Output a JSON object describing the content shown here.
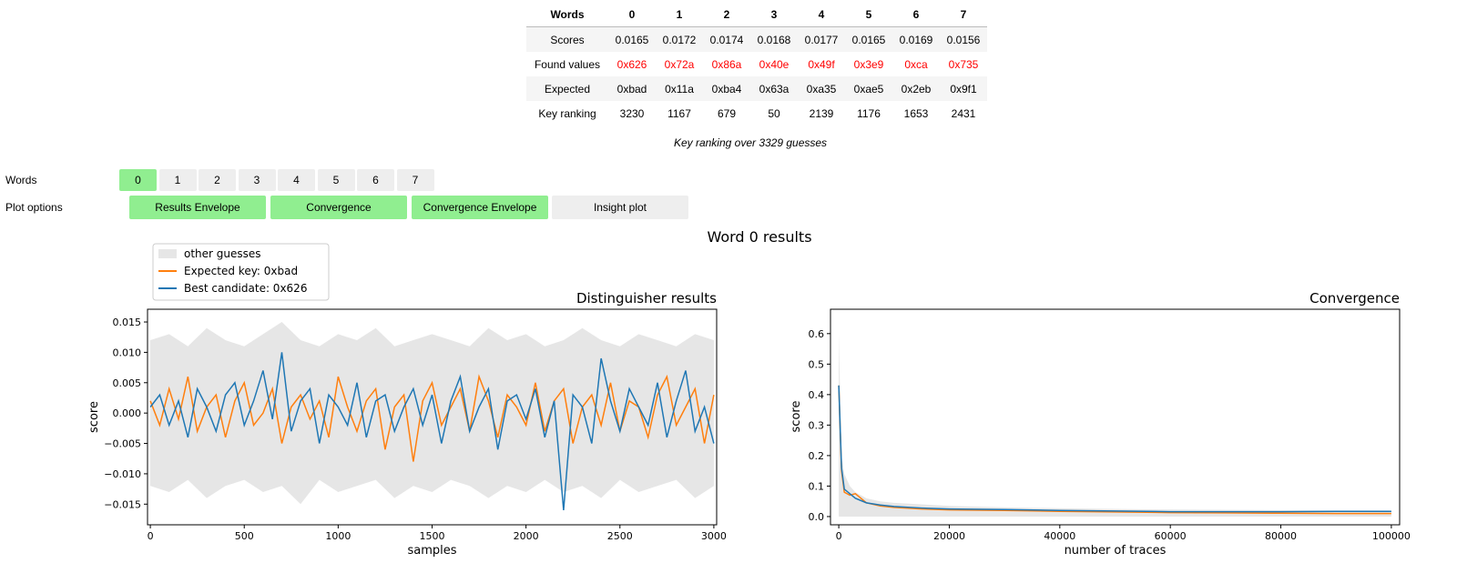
{
  "table": {
    "header_label": "Words",
    "columns": [
      "0",
      "1",
      "2",
      "3",
      "4",
      "5",
      "6",
      "7"
    ],
    "rows": [
      {
        "label": "Scores",
        "values": [
          "0.0165",
          "0.0172",
          "0.0174",
          "0.0168",
          "0.0177",
          "0.0165",
          "0.0169",
          "0.0156"
        ]
      },
      {
        "label": "Found values",
        "values": [
          "0x626",
          "0x72a",
          "0x86a",
          "0x40e",
          "0x49f",
          "0x3e9",
          "0xca",
          "0x735"
        ],
        "color": "#ff0000"
      },
      {
        "label": "Expected",
        "values": [
          "0xbad",
          "0x11a",
          "0xba4",
          "0x63a",
          "0xa35",
          "0xae5",
          "0x2eb",
          "0x9f1"
        ]
      },
      {
        "label": "Key ranking",
        "values": [
          "3230",
          "1167",
          "679",
          "50",
          "2139",
          "1176",
          "1653",
          "2431"
        ]
      }
    ],
    "caption": "Key ranking over 3329 guesses"
  },
  "controls": {
    "words_label": "Words",
    "words": [
      {
        "label": "0",
        "selected": true
      },
      {
        "label": "1",
        "selected": false
      },
      {
        "label": "2",
        "selected": false
      },
      {
        "label": "3",
        "selected": false
      },
      {
        "label": "4",
        "selected": false
      },
      {
        "label": "5",
        "selected": false
      },
      {
        "label": "6",
        "selected": false
      },
      {
        "label": "7",
        "selected": false
      }
    ],
    "plot_options_label": "Plot options",
    "plot_options": [
      {
        "label": "Results Envelope",
        "selected": true
      },
      {
        "label": "Convergence",
        "selected": true
      },
      {
        "label": "Convergence Envelope",
        "selected": true
      },
      {
        "label": "Insight plot",
        "selected": false
      }
    ],
    "selected_color": "#90ee90",
    "unselected_color": "#eeeeee"
  },
  "figure_title": "Word 0 results",
  "legend": [
    {
      "label": "other guesses",
      "color": "#e6e6e6",
      "kind": "patch"
    },
    {
      "label": "Expected key: 0xbad",
      "color": "#ff7f0e",
      "kind": "line"
    },
    {
      "label": "Best candidate: 0x626",
      "color": "#1f77b4",
      "kind": "line"
    }
  ],
  "chart_data": [
    {
      "type": "line",
      "title": "Distinguisher results",
      "xlabel": "samples",
      "ylabel": "score",
      "xlim": [
        -15,
        3015
      ],
      "ylim": [
        -0.0184,
        0.0171
      ],
      "xticks": [
        0,
        500,
        1000,
        1500,
        2000,
        2500,
        3000
      ],
      "yticks": [
        -0.015,
        -0.01,
        -0.005,
        0.0,
        0.005,
        0.01,
        0.015
      ],
      "ytick_labels": [
        "−0.015",
        "−0.010",
        "−0.005",
        "0.000",
        "0.005",
        "0.010",
        "0.015"
      ],
      "grid": false,
      "envelope": {
        "name": "other guesses",
        "x": [
          0,
          100,
          200,
          300,
          400,
          500,
          600,
          700,
          800,
          900,
          1000,
          1100,
          1200,
          1300,
          1400,
          1500,
          1600,
          1700,
          1800,
          1900,
          2000,
          2100,
          2200,
          2300,
          2400,
          2500,
          2600,
          2700,
          2800,
          2900,
          3000
        ],
        "upper": [
          0.012,
          0.013,
          0.011,
          0.014,
          0.012,
          0.011,
          0.013,
          0.015,
          0.012,
          0.011,
          0.013,
          0.012,
          0.014,
          0.011,
          0.012,
          0.013,
          0.012,
          0.011,
          0.014,
          0.012,
          0.013,
          0.011,
          0.012,
          0.014,
          0.012,
          0.011,
          0.013,
          0.012,
          0.011,
          0.013,
          0.012
        ],
        "lower": [
          -0.012,
          -0.013,
          -0.011,
          -0.014,
          -0.012,
          -0.011,
          -0.013,
          -0.012,
          -0.015,
          -0.011,
          -0.013,
          -0.012,
          -0.011,
          -0.014,
          -0.012,
          -0.013,
          -0.011,
          -0.012,
          -0.014,
          -0.012,
          -0.013,
          -0.011,
          -0.013,
          -0.012,
          -0.014,
          -0.011,
          -0.013,
          -0.012,
          -0.011,
          -0.014,
          -0.012
        ]
      },
      "series": [
        {
          "name": "Expected key: 0xbad",
          "color": "#ff7f0e",
          "x_step": 50,
          "values": [
            0.002,
            -0.002,
            0.004,
            -0.001,
            0.006,
            -0.003,
            0.001,
            0.003,
            -0.004,
            0.002,
            0.005,
            -0.002,
            0.0,
            0.004,
            -0.005,
            0.001,
            0.003,
            -0.001,
            0.002,
            -0.004,
            0.006,
            0.001,
            -0.003,
            0.002,
            0.004,
            -0.006,
            0.001,
            0.003,
            -0.008,
            0.002,
            0.005,
            -0.002,
            0.001,
            0.004,
            -0.003,
            0.006,
            0.002,
            -0.004,
            0.003,
            0.001,
            -0.002,
            0.005,
            -0.003,
            0.002,
            0.004,
            -0.005,
            0.001,
            0.003,
            -0.002,
            0.005,
            -0.003,
            0.002,
            0.001,
            -0.004,
            0.003,
            0.006,
            -0.002,
            0.001,
            0.004,
            -0.005,
            0.003
          ]
        },
        {
          "name": "Best candidate: 0x626",
          "color": "#1f77b4",
          "x_step": 50,
          "values": [
            0.001,
            0.003,
            -0.002,
            0.002,
            -0.004,
            0.004,
            0.001,
            -0.003,
            0.003,
            0.005,
            -0.002,
            0.002,
            0.007,
            -0.001,
            0.01,
            -0.003,
            0.002,
            0.004,
            -0.005,
            0.003,
            0.001,
            -0.002,
            0.005,
            -0.004,
            0.002,
            0.003,
            -0.003,
            0.001,
            0.004,
            -0.002,
            0.003,
            -0.005,
            0.002,
            0.006,
            -0.003,
            0.001,
            0.004,
            -0.006,
            0.002,
            0.003,
            -0.001,
            0.004,
            -0.004,
            0.002,
            -0.016,
            0.003,
            0.001,
            -0.005,
            0.009,
            0.002,
            -0.003,
            0.004,
            0.001,
            -0.002,
            0.005,
            -0.004,
            0.002,
            0.007,
            -0.003,
            0.001,
            -0.005
          ]
        }
      ]
    },
    {
      "type": "line",
      "title": "Convergence",
      "xlabel": "number of traces",
      "ylabel": "score",
      "xlim": [
        -1500,
        101500
      ],
      "ylim": [
        -0.027,
        0.68
      ],
      "xticks": [
        0,
        20000,
        40000,
        60000,
        80000,
        100000
      ],
      "yticks": [
        0.0,
        0.1,
        0.2,
        0.3,
        0.4,
        0.5,
        0.6
      ],
      "grid": false,
      "envelope": {
        "name": "other guesses",
        "x": [
          0,
          500,
          1000,
          2000,
          3000,
          5000,
          7500,
          10000,
          15000,
          20000,
          30000,
          40000,
          50000,
          60000,
          70000,
          80000,
          90000,
          100000
        ],
        "upper": [
          0.6,
          0.2,
          0.14,
          0.1,
          0.08,
          0.06,
          0.05,
          0.045,
          0.04,
          0.035,
          0.03,
          0.027,
          0.025,
          0.023,
          0.022,
          0.021,
          0.02,
          0.02
        ],
        "lower": [
          0,
          0,
          0,
          0,
          0,
          0,
          0,
          0,
          0,
          0,
          0,
          0,
          0,
          0,
          0,
          0,
          0,
          0
        ]
      },
      "series": [
        {
          "name": "Expected key: 0xbad",
          "color": "#ff7f0e",
          "x": [
            0,
            500,
            1000,
            2000,
            3000,
            5000,
            7500,
            10000,
            15000,
            20000,
            30000,
            40000,
            50000,
            60000,
            70000,
            80000,
            90000,
            100000
          ],
          "values": [
            0.43,
            0.15,
            0.08,
            0.07,
            0.075,
            0.045,
            0.035,
            0.03,
            0.025,
            0.022,
            0.02,
            0.017,
            0.015,
            0.013,
            0.012,
            0.011,
            0.01,
            0.01
          ]
        },
        {
          "name": "Best candidate: 0x626",
          "color": "#1f77b4",
          "x": [
            0,
            500,
            1000,
            2000,
            3000,
            5000,
            7500,
            10000,
            15000,
            20000,
            30000,
            40000,
            50000,
            60000,
            70000,
            80000,
            90000,
            100000
          ],
          "values": [
            0.43,
            0.16,
            0.09,
            0.075,
            0.06,
            0.045,
            0.038,
            0.033,
            0.028,
            0.025,
            0.023,
            0.02,
            0.018,
            0.016,
            0.016,
            0.016,
            0.017,
            0.017
          ]
        }
      ]
    }
  ]
}
